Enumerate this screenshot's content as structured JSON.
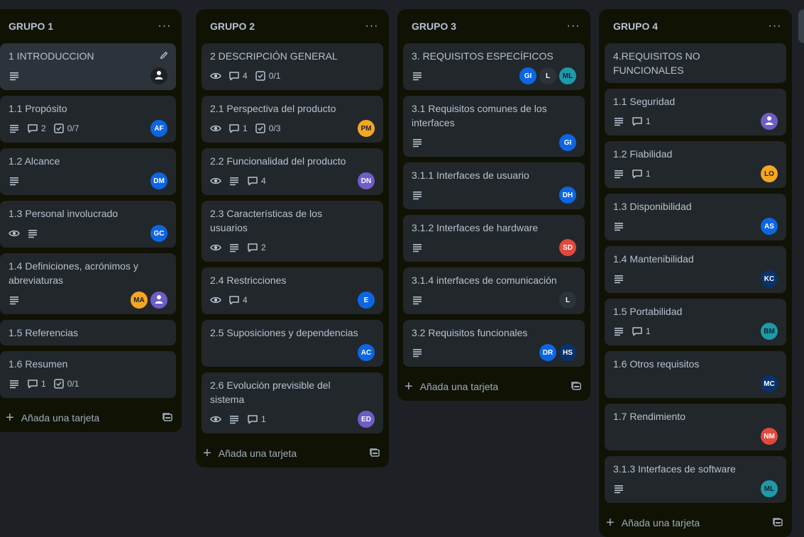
{
  "colors": {
    "board_bg": "#1d2125",
    "list_bg": "#101204",
    "card_bg": "#22272b",
    "text": "#b6c2cf"
  },
  "lists": [
    {
      "title": "GRUPO 1",
      "add_label": "Añada una tarjeta",
      "cards": [
        {
          "title": "1 INTRODUCCION",
          "icons": [
            "description"
          ],
          "members": [
            {
              "initials": "",
              "color": "#ffffff",
              "icon": "user-icon"
            }
          ]
        },
        {
          "title": "1.1 Propósito",
          "icons": [
            "description"
          ],
          "comments": "2",
          "checklist": "0/7",
          "members": [
            {
              "initials": "AF",
              "color": "#0c66e4"
            }
          ]
        },
        {
          "title": "1.2 Alcance",
          "icons": [
            "description"
          ],
          "members": [
            {
              "initials": "DM",
              "color": "#0c66e4"
            }
          ]
        },
        {
          "title": "1.3 Personal involucrado",
          "icons": [
            "watch",
            "description"
          ],
          "members": [
            {
              "initials": "GC",
              "color": "#0c66e4"
            }
          ]
        },
        {
          "title": "1.4 Definiciones, acrónimos y abreviaturas",
          "icons": [
            "description"
          ],
          "members": [
            {
              "initials": "MA",
              "color": "#f5a623"
            },
            {
              "initials": "",
              "color": "#6e5dc6",
              "icon": "user-icon"
            }
          ]
        },
        {
          "title": "1.5 Referencias"
        },
        {
          "title": "1.6 Resumen",
          "icons": [
            "description"
          ],
          "comments": "1",
          "checklist": "0/1"
        }
      ]
    },
    {
      "title": "GRUPO 2",
      "add_label": "Añada una tarjeta",
      "cards": [
        {
          "title": "2 DESCRIPCIÓN GENERAL",
          "icons": [
            "watch"
          ],
          "comments": "4",
          "checklist": "0/1"
        },
        {
          "title": "2.1 Perspectiva del producto",
          "icons": [
            "watch"
          ],
          "comments": "1",
          "checklist": "0/3",
          "members": [
            {
              "initials": "PM",
              "color": "#f5a623"
            }
          ]
        },
        {
          "title": "2.2 Funcionalidad del producto",
          "icons": [
            "watch",
            "description"
          ],
          "comments": "4",
          "members": [
            {
              "initials": "DN",
              "color": "#6e5dc6"
            }
          ]
        },
        {
          "title": "2.3 Características de los usuarios",
          "icons": [
            "watch",
            "description"
          ],
          "comments": "2"
        },
        {
          "title": "2.4 Restricciones",
          "icons": [
            "watch"
          ],
          "comments": "4",
          "members": [
            {
              "initials": "E",
              "color": "#0c66e4"
            }
          ]
        },
        {
          "title": "2.5 Suposiciones y dependencias",
          "members": [
            {
              "initials": "AC",
              "color": "#0c66e4"
            }
          ]
        },
        {
          "title": "2.6 Evolución previsible del sistema",
          "icons": [
            "watch",
            "description"
          ],
          "comments": "1",
          "members": [
            {
              "initials": "ED",
              "color": "#6e5dc6"
            }
          ]
        }
      ]
    },
    {
      "title": "GRUPO 3",
      "add_label": "Añada una tarjeta",
      "cards": [
        {
          "title": "3. REQUISITOS ESPECÍFICOS",
          "icons": [
            "description"
          ],
          "members": [
            {
              "initials": "GI",
              "color": "#0c66e4"
            },
            {
              "initials": "L",
              "color": "#2c333a"
            },
            {
              "initials": "ML",
              "color": "#1d9aaa"
            }
          ]
        },
        {
          "title": "3.1 Requisitos comunes de los interfaces",
          "icons": [
            "description"
          ],
          "members": [
            {
              "initials": "GI",
              "color": "#0c66e4"
            }
          ]
        },
        {
          "title": "3.1.1 Interfaces de usuario",
          "icons": [
            "description"
          ],
          "members": [
            {
              "initials": "DH",
              "color": "#0c66e4"
            }
          ]
        },
        {
          "title": "3.1.2 Interfaces de hardware",
          "icons": [
            "description"
          ],
          "members": [
            {
              "initials": "SD",
              "color": "#e2483d"
            }
          ]
        },
        {
          "title": "3.1.4 interfaces de comunicación",
          "icons": [
            "description"
          ],
          "members": [
            {
              "initials": "L",
              "color": "#2c333a"
            }
          ]
        },
        {
          "title": "3.2 Requisitos funcionales",
          "icons": [
            "description"
          ],
          "members": [
            {
              "initials": "DR",
              "color": "#0c66e4"
            },
            {
              "initials": "HS",
              "color": "#09326c"
            }
          ]
        }
      ]
    },
    {
      "title": "GRUPO 4",
      "add_label": "Añada una tarjeta",
      "cards": [
        {
          "title": "4.REQUISITOS NO FUNCIONALES"
        },
        {
          "title": "1.1 Seguridad",
          "icons": [
            "description"
          ],
          "comments": "1",
          "members": [
            {
              "initials": "",
              "color": "#6e5dc6",
              "icon": "user-icon"
            }
          ]
        },
        {
          "title": "1.2 Fiabilidad",
          "icons": [
            "description"
          ],
          "comments": "1",
          "members": [
            {
              "initials": "LO",
              "color": "#f5a623"
            }
          ]
        },
        {
          "title": "1.3 Disponibilidad",
          "icons": [
            "description"
          ],
          "members": [
            {
              "initials": "AS",
              "color": "#0c66e4"
            }
          ]
        },
        {
          "title": "1.4 Mantenibilidad",
          "icons": [
            "description"
          ],
          "members": [
            {
              "initials": "KC",
              "color": "#09326c"
            }
          ]
        },
        {
          "title": "1.5 Portabilidad",
          "icons": [
            "description"
          ],
          "comments": "1",
          "members": [
            {
              "initials": "BM",
              "color": "#1d9aaa"
            }
          ]
        },
        {
          "title": "1.6 Otros requisitos",
          "members": [
            {
              "initials": "MC",
              "color": "#09326c"
            }
          ]
        },
        {
          "title": "1.7 Rendimiento",
          "members": [
            {
              "initials": "NM",
              "color": "#e2483d"
            }
          ]
        },
        {
          "title": "3.1.3 Interfaces de software",
          "icons": [
            "description"
          ],
          "members": [
            {
              "initials": "ML",
              "color": "#1d9aaa"
            }
          ]
        }
      ]
    }
  ]
}
